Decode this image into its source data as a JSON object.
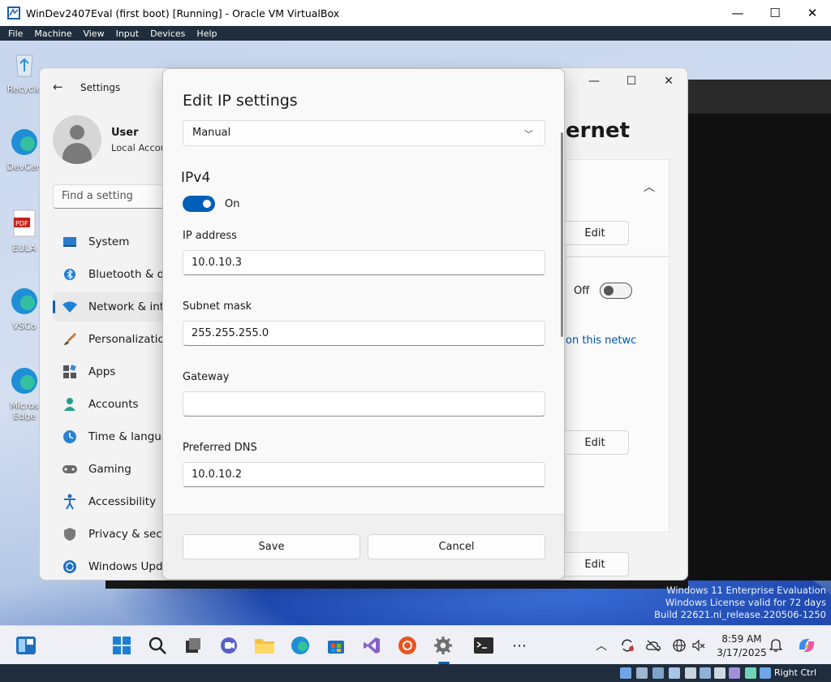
{
  "host": {
    "title": "WinDev2407Eval (first boot) [Running] - Oracle VM VirtualBox",
    "menu": [
      "File",
      "Machine",
      "View",
      "Input",
      "Devices",
      "Help"
    ],
    "host_key": "Right Ctrl"
  },
  "desktop": {
    "icons": [
      {
        "label": "Recycle",
        "name": "recycle-bin-icon"
      },
      {
        "label": "DevCen",
        "name": "devcenter-icon"
      },
      {
        "label": "EULA",
        "name": "pdf-icon"
      },
      {
        "label": "VSCo",
        "name": "vscode-icon"
      },
      {
        "label": "Micros Edge",
        "name": "edge-icon"
      }
    ],
    "watermark": [
      "Windows 11 Enterprise Evaluation",
      "Windows License valid for 72 days",
      "Build 22621.ni_release.220506-1250"
    ]
  },
  "settings": {
    "title": "Settings",
    "user_name": "User",
    "user_sub": "Local Accou",
    "search_placeholder": "Find a setting",
    "nav": [
      {
        "label": "System",
        "name": "nav-system"
      },
      {
        "label": "Bluetooth & de",
        "name": "nav-bluetooth"
      },
      {
        "label": "Network & inte",
        "name": "nav-network",
        "selected": true
      },
      {
        "label": "Personalization",
        "name": "nav-personalization"
      },
      {
        "label": "Apps",
        "name": "nav-apps"
      },
      {
        "label": "Accounts",
        "name": "nav-accounts"
      },
      {
        "label": "Time & langua",
        "name": "nav-time-language"
      },
      {
        "label": "Gaming",
        "name": "nav-gaming"
      },
      {
        "label": "Accessibility",
        "name": "nav-accessibility"
      },
      {
        "label": "Privacy & secu",
        "name": "nav-privacy"
      },
      {
        "label": "Windows Upda",
        "name": "nav-windows-update"
      }
    ],
    "page_title_partial": "ernet",
    "edit_label": "Edit",
    "toggle_label": "Off",
    "link_partial": "on this netwc"
  },
  "dialog": {
    "title": "Edit IP settings",
    "mode": "Manual",
    "section": "IPv4",
    "ipv4_toggle_label": "On",
    "fields": {
      "ip_label": "IP address",
      "ip_value": "10.0.10.3",
      "subnet_label": "Subnet mask",
      "subnet_value": "255.255.255.0",
      "gateway_label": "Gateway",
      "gateway_value": "",
      "dns_label": "Preferred DNS",
      "dns_value": "10.0.10.2"
    },
    "save_label": "Save",
    "cancel_label": "Cancel"
  },
  "taskbar": {
    "time": "8:59 AM",
    "date": "3/17/2025"
  },
  "colors": {
    "accent": "#005fb8",
    "vbox_bar": "#1f2d3d"
  }
}
